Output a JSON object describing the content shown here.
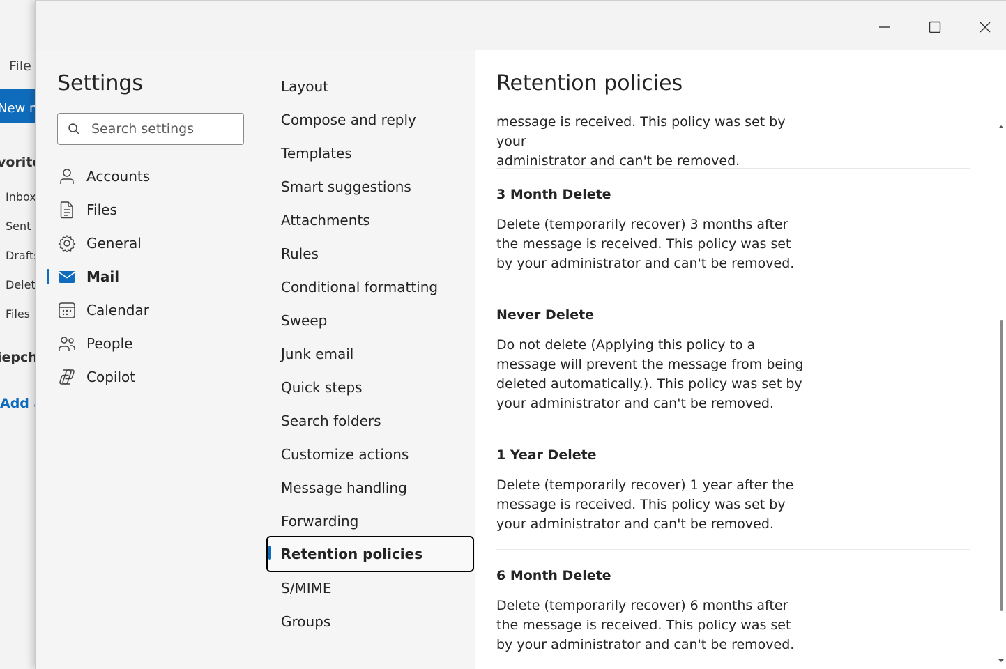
{
  "background_app": {
    "file_menu": "File",
    "new_button": "New m",
    "favorites": "vorites",
    "folders": [
      "Inbox",
      "Sent I",
      "Drafts",
      "Delete",
      "Files"
    ],
    "account": "iepch",
    "add_link": "Add a"
  },
  "window": {
    "minimize_icon": "minimize-icon",
    "maximize_icon": "maximize-icon",
    "close_icon": "close-icon"
  },
  "settings": {
    "title": "Settings",
    "search_placeholder": "Search settings",
    "nav": [
      {
        "label": "Accounts",
        "icon": "person-icon",
        "active": false
      },
      {
        "label": "Files",
        "icon": "document-icon",
        "active": false
      },
      {
        "label": "General",
        "icon": "gear-icon",
        "active": false
      },
      {
        "label": "Mail",
        "icon": "mail-icon",
        "active": true
      },
      {
        "label": "Calendar",
        "icon": "calendar-icon",
        "active": false
      },
      {
        "label": "People",
        "icon": "people-icon",
        "active": false
      },
      {
        "label": "Copilot",
        "icon": "copilot-icon",
        "active": false
      }
    ]
  },
  "mail_nav": [
    "Layout",
    "Compose and reply",
    "Templates",
    "Smart suggestions",
    "Attachments",
    "Rules",
    "Conditional formatting",
    "Sweep",
    "Junk email",
    "Quick steps",
    "Search folders",
    "Customize actions",
    "Message handling",
    "Forwarding",
    "Retention policies",
    "S/MIME",
    "Groups"
  ],
  "mail_nav_active": "Retention policies",
  "panel": {
    "title": "Retention policies",
    "partial_description": "message is received. This policy was set by your\nadministrator and can't be removed.",
    "policies": [
      {
        "name": "3 Month Delete",
        "description": "Delete (temporarily recover) 3 months after the message is received. This policy was set by your administrator and can't be removed."
      },
      {
        "name": "Never Delete",
        "description": "Do not delete (Applying this policy to a message will prevent the message from being deleted automatically.). This policy was set by your administrator and can't be removed."
      },
      {
        "name": "1 Year Delete",
        "description": "Delete (temporarily recover) 1 year after the message is received. This policy was set by your administrator and can't be removed."
      },
      {
        "name": "6 Month Delete",
        "description": "Delete (temporarily recover) 6 months after the message is received. This policy was set by your administrator and can't be removed."
      }
    ]
  },
  "colors": {
    "accent": "#0f6cbd",
    "text": "#242424",
    "panel_bg": "#ffffff",
    "nav_bg": "#f5f5f5"
  }
}
